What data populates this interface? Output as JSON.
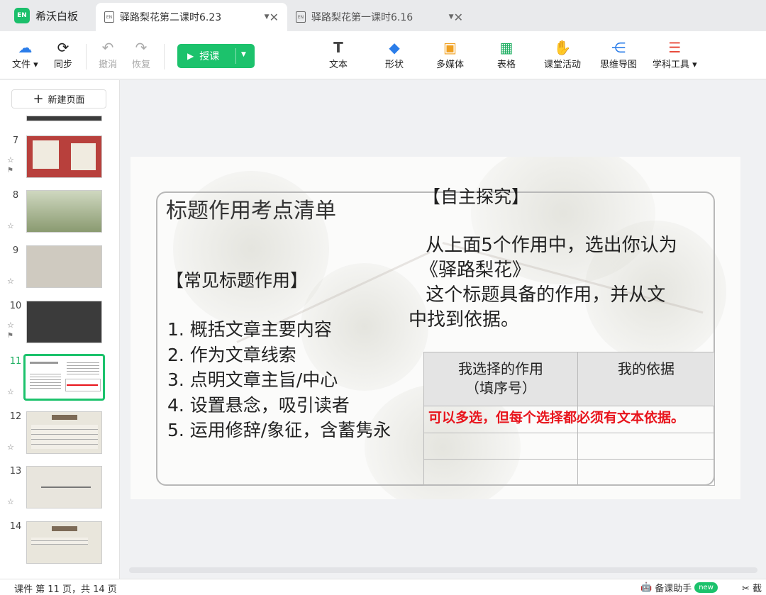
{
  "app": {
    "name": "希沃白板",
    "logo_text": "EN"
  },
  "tabs": [
    {
      "label": "驿路梨花第二课时6.23",
      "active": true
    },
    {
      "label": "驿路梨花第一课时6.16",
      "active": false
    }
  ],
  "toolbar": {
    "file": "文件",
    "sync": "同步",
    "undo": "撤消",
    "redo": "恢复",
    "teach": "授课",
    "text": "文本",
    "shape": "形状",
    "media": "多媒体",
    "table": "表格",
    "activity": "课堂活动",
    "mindmap": "思维导图",
    "subject_tools": "学科工具"
  },
  "sidebar": {
    "new_page": "新建页面",
    "thumbnails": [
      {
        "num": "7"
      },
      {
        "num": "8"
      },
      {
        "num": "9"
      },
      {
        "num": "10"
      },
      {
        "num": "11",
        "selected": true
      },
      {
        "num": "12"
      },
      {
        "num": "13"
      },
      {
        "num": "14"
      }
    ]
  },
  "slide": {
    "title": "标题作用考点清单",
    "left_section": "【常见标题作用】",
    "functions": [
      "1. 概括文章主要内容",
      "2. 作为文章线索",
      "3. 点明文章主旨/中心",
      "4. 设置悬念，吸引读者",
      "5. 运用修辞/象征，含蓄隽永"
    ],
    "right_section": "【自主探究】",
    "instruction_l1": " 从上面5个作用中，选出你认为",
    "instruction_l2": "《驿路梨花》",
    "instruction_l3": " 这个标题具备的作用，并从文",
    "instruction_l4": "中找到依据。",
    "table_header_1a": "我选择的作用",
    "table_header_1b": "（填序号）",
    "table_header_2": "我的依据",
    "note": "可以多选，但每个选择都必须有文本依据。"
  },
  "status": {
    "text": "课件 第 11 页，共 14 页",
    "assistant": "备课助手",
    "new_badge": "new",
    "cut": "截"
  },
  "colors": {
    "accent_green": "#1cc26c",
    "note_red": "#e8141c"
  }
}
